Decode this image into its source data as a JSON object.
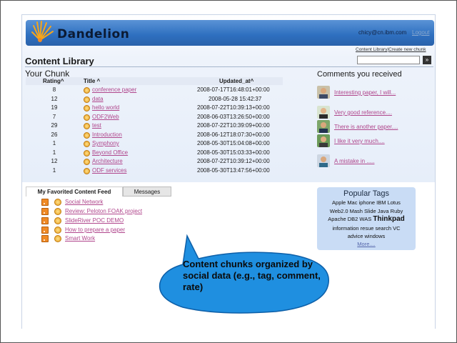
{
  "app": {
    "name": "Dandelion",
    "user_email": "chicy@cn.ibm.com",
    "logout_label": "Logout"
  },
  "toplinks": {
    "content_library": "Content Library",
    "separator": " | ",
    "create_new": "Create new chunk"
  },
  "search": {
    "button_label": "»",
    "placeholder": ""
  },
  "page_title": "Content Library",
  "chunk_section": {
    "title": "Your Chunk",
    "headers": {
      "rating": "Rating^",
      "title": "Title ^",
      "updated": "Updated_at^"
    },
    "rows": [
      {
        "rating": "8",
        "title": "conference paper",
        "updated": "2008-07-17T16:48:01+00:00"
      },
      {
        "rating": "12",
        "title": "data",
        "updated": "2008-05-28 15:42:37"
      },
      {
        "rating": "19",
        "title": "hello world",
        "updated": "2008-07-22T10:39:13+00:00"
      },
      {
        "rating": "7",
        "title": "ODF2Web",
        "updated": "2008-06-03T13:26:50+00:00"
      },
      {
        "rating": "29",
        "title": "test",
        "updated": "2008-07-22T10:39:09+00:00"
      },
      {
        "rating": "26",
        "title": "Introduction",
        "updated": "2008-06-12T18:07:30+00:00"
      },
      {
        "rating": "1",
        "title": "Symphony",
        "updated": "2008-05-30T15:04:08+00:00"
      },
      {
        "rating": "1",
        "title": "Beyond Office",
        "updated": "2008-05-30T15:03:33+00:00"
      },
      {
        "rating": "12",
        "title": "Architecture",
        "updated": "2008-07-22T10:39:12+00:00"
      },
      {
        "rating": "1",
        "title": "ODF services",
        "updated": "2008-05-30T13:47:56+00:00"
      }
    ]
  },
  "comments": {
    "title": "Comments you received",
    "items": [
      {
        "text": "Interesting paper, I will..."
      },
      {
        "text": "Very good reference...."
      },
      {
        "text": "There is another paper...."
      },
      {
        "text": "I like it very much...."
      },
      {
        "text": "A mistake in ....."
      }
    ]
  },
  "feed": {
    "tab_favorite": "My Favorited Content Feed",
    "tab_messages": "Messages",
    "items": [
      {
        "text": "Social Network"
      },
      {
        "text": "Review: Peloton FOAK project"
      },
      {
        "text": "SlideRiver POC DEMO"
      },
      {
        "text": "How to prepare a paper"
      },
      {
        "text": "Smart Work"
      }
    ]
  },
  "popular_tags": {
    "title": "Popular Tags",
    "line1": "Apple Mac iphone IBM Lotus",
    "line2": "Web2.0 Mash Slide Java Ruby",
    "line3_pre": "Apache DB2 WAS ",
    "line3_big": "Thinkpad",
    "line4": "information resue search VC",
    "line5": "advice windows",
    "more": "More...."
  },
  "callout": {
    "text": "Content chunks organized by social data (e.g., tag, comment, rate)"
  },
  "colors": {
    "header_blue": "#2e6fbf",
    "link_magenta": "#b0468c",
    "callout_blue": "#1f8fe0",
    "tags_panel": "#c9dcf5"
  }
}
